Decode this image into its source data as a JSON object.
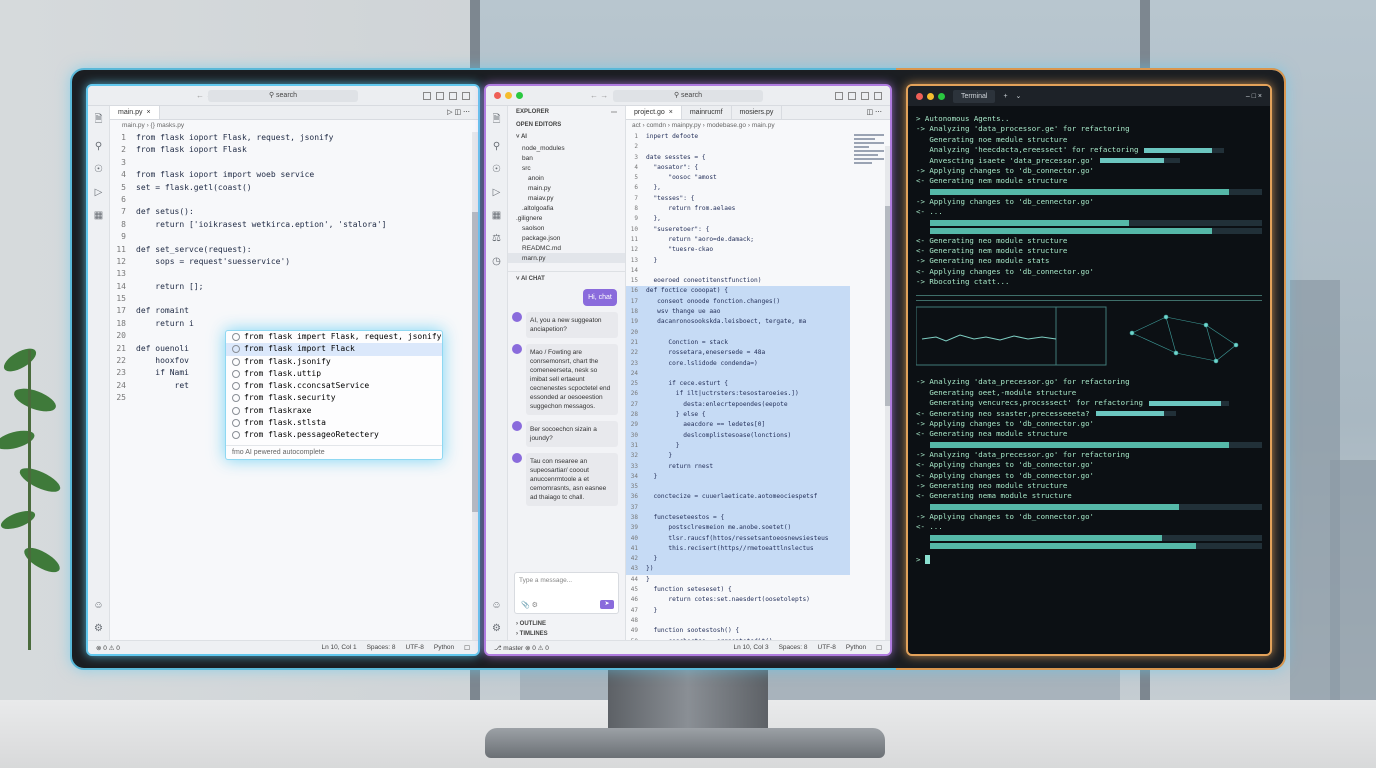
{
  "left_editor": {
    "search": "search",
    "tab": "main.py",
    "breadcrumb": "main.py  ›  {} masks.py",
    "lines": [
      {
        "n": "1",
        "code": "from flask ioport Flask, request, jsonify"
      },
      {
        "n": "2",
        "code": "from flask ioport Flask"
      },
      {
        "n": "3",
        "code": ""
      },
      {
        "n": "4",
        "code": "from flask ioport import woeb service"
      },
      {
        "n": "5",
        "code": "set = flask.getl(coast()"
      },
      {
        "n": "6",
        "code": ""
      },
      {
        "n": "7",
        "code": "def setus():"
      },
      {
        "n": "8",
        "code": "    return ['ioikrasest wetkirca.eption', 'stalora']"
      },
      {
        "n": "9",
        "code": ""
      },
      {
        "n": "11",
        "code": "def set_servce(request):"
      },
      {
        "n": "12",
        "code": "    sops = request'suesservice')"
      },
      {
        "n": "13",
        "code": ""
      },
      {
        "n": "14",
        "code": "    return [];"
      },
      {
        "n": "15",
        "code": ""
      },
      {
        "n": "17",
        "code": "def romaint"
      },
      {
        "n": "18",
        "code": "    return i"
      },
      {
        "n": "20",
        "code": ""
      },
      {
        "n": "21",
        "code": "def ouenoli"
      },
      {
        "n": "22",
        "code": "    hooxfov"
      },
      {
        "n": "23",
        "code": "    if Nami"
      },
      {
        "n": "24",
        "code": "        ret"
      },
      {
        "n": "25",
        "code": ""
      }
    ],
    "autocomplete": {
      "items": [
        "from flask impert Flask, request, jsonify",
        "from flask import Flack",
        "from flask.jsonify",
        "from flask.uttip",
        "from flask.cconcsatService",
        "from flask.security",
        "from flaskraxe",
        "from flask.stlsta",
        "from flask.pessageoRetectery"
      ],
      "selected_index": 1,
      "footer": "fmo AI pewered autocomplete"
    },
    "status": {
      "left": "⊗ 0 ⚠ 0",
      "position": "Ln 10, Col 1",
      "spaces": "Spaces: 8",
      "encoding": "UTF-8",
      "language": "Python"
    }
  },
  "mid_editor": {
    "search": "search",
    "tabs": [
      "project.go",
      "mainrucmf",
      "mosiers.py"
    ],
    "breadcrumb": "act  ›  comdn  ›  mainpy.py  ›  modebase.go  ›  main.py",
    "explorer": {
      "title": "EXPLORER",
      "open_editors": "OPEN EDITORS",
      "folder": "AI",
      "items": [
        "node_modules",
        "ban",
        "src",
        "anoin",
        "main.py",
        "maiav.py",
        ".altolgoafia",
        ".gilignere",
        "saolson",
        "package.json",
        "READMC.md",
        "marn.py"
      ],
      "ai_chat": "AI CHAT",
      "user_msg": "Hi, chat",
      "messages": [
        "AI, you a new suggeaton anciapetion?",
        "Mao / Fowting are conrsemonsrt, chart the comeneerseta, nesk so imibat sell ertaeunt cecnenestes scpoctetel end essonded ar oesoeestion suggechon messagos.",
        "Ber socoechcn sizain a joundy?",
        "Tau con nsearee an supeosartiar/ cooout anuccenrmtoole a et cemomrasnts, asn easnee ad thaiago tc chall."
      ],
      "input_placeholder": "Type a message...",
      "outline": "OUTLINE",
      "timeline": "TIMLINES"
    },
    "lines": [
      {
        "n": "1",
        "code": "inpert defoote",
        "hl": false
      },
      {
        "n": "2",
        "code": "",
        "hl": false
      },
      {
        "n": "3",
        "code": "date sesstes = {",
        "hl": false
      },
      {
        "n": "4",
        "code": "  \"aosator\": {",
        "hl": false
      },
      {
        "n": "5",
        "code": "      \"oosoc \"amost",
        "hl": false
      },
      {
        "n": "6",
        "code": "  },",
        "hl": false
      },
      {
        "n": "7",
        "code": "  \"tesses\": {",
        "hl": false
      },
      {
        "n": "8",
        "code": "      return from.aelaes",
        "hl": false
      },
      {
        "n": "9",
        "code": "  },",
        "hl": false
      },
      {
        "n": "10",
        "code": "  \"suseretoer\": {",
        "hl": false
      },
      {
        "n": "11",
        "code": "      return \"aoro=de.damack;",
        "hl": false
      },
      {
        "n": "12",
        "code": "      \"tuesre-ckao",
        "hl": false
      },
      {
        "n": "13",
        "code": "  }",
        "hl": false
      },
      {
        "n": "14",
        "code": "",
        "hl": false
      },
      {
        "n": "15",
        "code": "  eoeroed coneotitenstfunction)",
        "hl": false
      },
      {
        "n": "16",
        "code": "def foctice cooopat) {",
        "hl": true
      },
      {
        "n": "17",
        "code": "   conseot onoode fonction.changes()",
        "hl": true
      },
      {
        "n": "18",
        "code": "   wsv thange ue aao",
        "hl": true
      },
      {
        "n": "19",
        "code": "   dacanronosookskda.leisboect, tergate, ma",
        "hl": true
      },
      {
        "n": "20",
        "code": "",
        "hl": true
      },
      {
        "n": "21",
        "code": "      Conction = stack",
        "hl": true
      },
      {
        "n": "22",
        "code": "      rossetara,enesersede = 48a",
        "hl": true
      },
      {
        "n": "23",
        "code": "      core.lslidode condenda=)",
        "hl": true
      },
      {
        "n": "24",
        "code": "",
        "hl": true
      },
      {
        "n": "25",
        "code": "      if cece.esturt {",
        "hl": true
      },
      {
        "n": "26",
        "code": "        if ilt|uctrsters:tesostaroeies.])",
        "hl": true
      },
      {
        "n": "27",
        "code": "          desta:enlecrtepoendes(eepote",
        "hl": true
      },
      {
        "n": "28",
        "code": "        } else {",
        "hl": true
      },
      {
        "n": "29",
        "code": "          aeacdore == ledetes[0]",
        "hl": true
      },
      {
        "n": "30",
        "code": "          deslcomplistesoase(lonctions)",
        "hl": true
      },
      {
        "n": "31",
        "code": "        }",
        "hl": true
      },
      {
        "n": "32",
        "code": "      }",
        "hl": true
      },
      {
        "n": "33",
        "code": "      return rnest",
        "hl": true
      },
      {
        "n": "34",
        "code": "  }",
        "hl": true
      },
      {
        "n": "35",
        "code": "",
        "hl": true
      },
      {
        "n": "36",
        "code": "  conctecize = cuuerlaeticate.aotomeociespetsf",
        "hl": true
      },
      {
        "n": "37",
        "code": "",
        "hl": true
      },
      {
        "n": "38",
        "code": "  functeseteestos = {",
        "hl": true
      },
      {
        "n": "39",
        "code": "      postsclresmeion me.anobe.soetet()",
        "hl": true
      },
      {
        "n": "40",
        "code": "      tlsr.raucsf(httos/ressetsantoeosnewsiesteus",
        "hl": true
      },
      {
        "n": "41",
        "code": "      this.recisert(https//rmetoeattlnslectus",
        "hl": true
      },
      {
        "n": "42",
        "code": "  }",
        "hl": true
      },
      {
        "n": "43",
        "code": "})",
        "hl": true
      },
      {
        "n": "44",
        "code": "}",
        "hl": false
      },
      {
        "n": "45",
        "code": "  function seteseset) {",
        "hl": false
      },
      {
        "n": "46",
        "code": "      return cotes:set.naesdert(oosetolepts)",
        "hl": false
      },
      {
        "n": "47",
        "code": "  }",
        "hl": false
      },
      {
        "n": "48",
        "code": "",
        "hl": false
      },
      {
        "n": "49",
        "code": "  function sootestosh() {",
        "hl": false
      },
      {
        "n": "50",
        "code": "      coscbectse = ergaentetsdit()",
        "hl": false
      },
      {
        "n": "51",
        "code": "",
        "hl": false
      },
      {
        "n": "52",
        "code": "      Adate eno-sotonteeltattle,sestl})",
        "hl": false
      },
      {
        "n": "53",
        "code": "      aastta.aesetant\"Tertesin-Asde on \"Retle.\", \"ore",
        "hl": false
      },
      {
        "n": "54",
        "code": "      return true",
        "hl": false
      },
      {
        "n": "55",
        "code": "  }",
        "hl": false
      },
      {
        "n": "56",
        "code": "}",
        "hl": false
      }
    ],
    "status": {
      "left": "⎇ master  ⊗ 0 ⚠ 0",
      "position": "Ln 10, Col 3",
      "spaces": "Spaces: 8",
      "encoding": "UTF-8",
      "language": "Python"
    }
  },
  "terminal": {
    "tab": "Terminal",
    "lines": [
      {
        "text": "> Autonomous Agents..",
        "bar": null
      },
      {
        "text": "-> Analyzing 'data_processor.ge' for refactoring",
        "bar": null
      },
      {
        "text": "   Generating noe medule structure",
        "bar": null
      },
      {
        "text": "   Analyzing 'heecdacta,ereessect' for refactoring",
        "bar": 0.85
      },
      {
        "text": "   Anvescting isaete 'data_precessor.go'",
        "bar": 0.8
      },
      {
        "text": "-> Applying changes to 'db_connector.go'",
        "bar": null
      },
      {
        "text": "<- Generating nem module structure",
        "bar": null
      },
      {
        "text": "",
        "progress": 0.9
      },
      {
        "text": "-> Applying changes to 'db_cennector.go'",
        "bar": null
      },
      {
        "text": "<- ...",
        "bar": null
      },
      {
        "text": "",
        "progress": 0.6
      },
      {
        "text": "",
        "progress": 0.85
      },
      {
        "text": "<- Generating neo module structure",
        "bar": null
      },
      {
        "text": "<- Generating nem module structure",
        "bar": null
      },
      {
        "text": "-> Generating neo module stats",
        "bar": null
      },
      {
        "text": "<- Applying changes to 'db_connector.go'",
        "bar": null
      },
      {
        "text": "-> Rbocoting ctatt...",
        "bar": null
      }
    ],
    "lines2": [
      {
        "text": "-> Analyzing 'data_precessor.go' for refactoring",
        "bar": null
      },
      {
        "text": "   Generating oeet,-module structure",
        "bar": null
      },
      {
        "text": "   Generating vencurecs,procsssect' for refactoring",
        "bar": 0.9
      },
      {
        "text": "<- Generating neo ssaster,precesseeeta?",
        "bar": 0.85
      },
      {
        "text": "-> Applying changes to 'db_connector.go'",
        "bar": null
      },
      {
        "text": "<- Generating nea module structure",
        "bar": null
      },
      {
        "text": "",
        "progress": 0.9
      },
      {
        "text": "-> Analyzing 'data_precessor.go' for refactoring",
        "bar": null
      },
      {
        "text": "<- Applying changes to 'db_connector.go'",
        "bar": null
      },
      {
        "text": "<- Applying changes to 'db_connector.go'",
        "bar": null
      },
      {
        "text": "-> Generating neo module structure",
        "bar": null
      },
      {
        "text": "<- Generating nema module structure",
        "bar": null
      },
      {
        "text": "",
        "progress": 0.75
      },
      {
        "text": "-> Applying changes to 'db_connector.go'",
        "bar": null
      },
      {
        "text": "<- ...",
        "bar": null
      },
      {
        "text": "",
        "progress": 0.7
      },
      {
        "text": "",
        "progress": 0.8
      }
    ],
    "prompt": ">"
  }
}
